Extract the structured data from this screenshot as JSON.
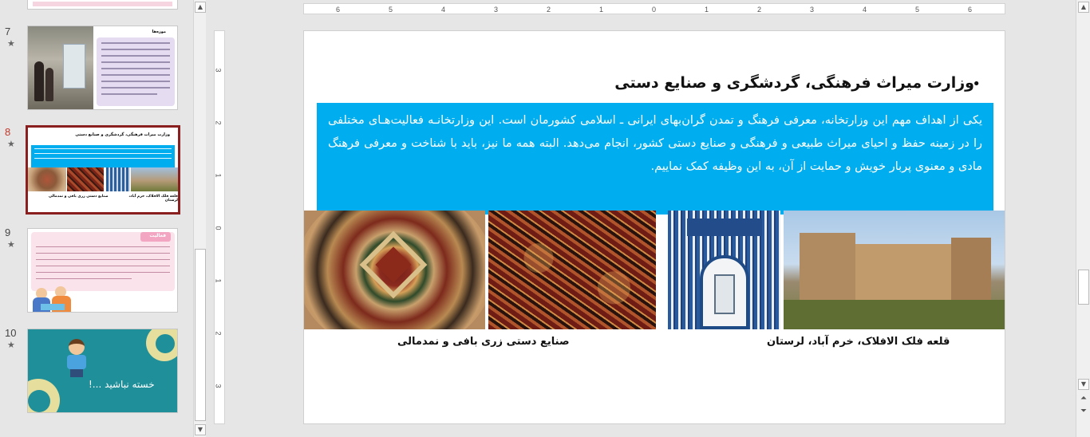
{
  "thumbnails": [
    {
      "number": "7",
      "star": "★",
      "heading": "موزه‌ها"
    },
    {
      "number": "8",
      "star": "★",
      "heading": "وزارت میراث فرهنگی، گردشگری و صنایع دستی",
      "caption_left": "صنایع دستی زری بافی و نمدمالی",
      "caption_right": "قلعه فلک الافلاک، خرم آباد، لرستان"
    },
    {
      "number": "9",
      "star": "★",
      "heading": "فعالیت"
    },
    {
      "number": "10",
      "star": "★",
      "heading": "خسته نباشید ...!"
    }
  ],
  "ruler": {
    "h_ticks": [
      "6",
      "5",
      "4",
      "3",
      "2",
      "1",
      "0",
      "1",
      "2",
      "3",
      "4",
      "5",
      "6"
    ],
    "v_ticks": [
      "3",
      "2",
      "1",
      "0",
      "1",
      "2",
      "3"
    ]
  },
  "slide": {
    "bullet": "•",
    "title": "وزارت میراث فرهنگی، گردشگری و صنایع دستی",
    "paragraph": "یکی از اهداف مهم این وزارتخانه، معرفی فرهنگ و تمدن گران‌بهای ایرانی ـ اسلامی کشورمان است. این وزارتخانـه فعالیت‌هـای مختلفی را در زمینه حفظ و احیای میراث طبیعی و فرهنگی و صنایع دستی کشور، انجام می‌دهد. البته همه ما نیز، باید با شناخت و معرفی فرهنگ مادی و معنوی پربار خویش و حمایت از آن، به این وظیفه کمک نماییم.",
    "caption_left": "صنایع دستی زری بافی و نمدمالی",
    "caption_right": "قلعه فلک الافلاک، خرم آباد، لرستان"
  },
  "colors": {
    "blue": "#00aeef",
    "selected_border": "#8a1f1f",
    "active_number": "#c0392b"
  }
}
